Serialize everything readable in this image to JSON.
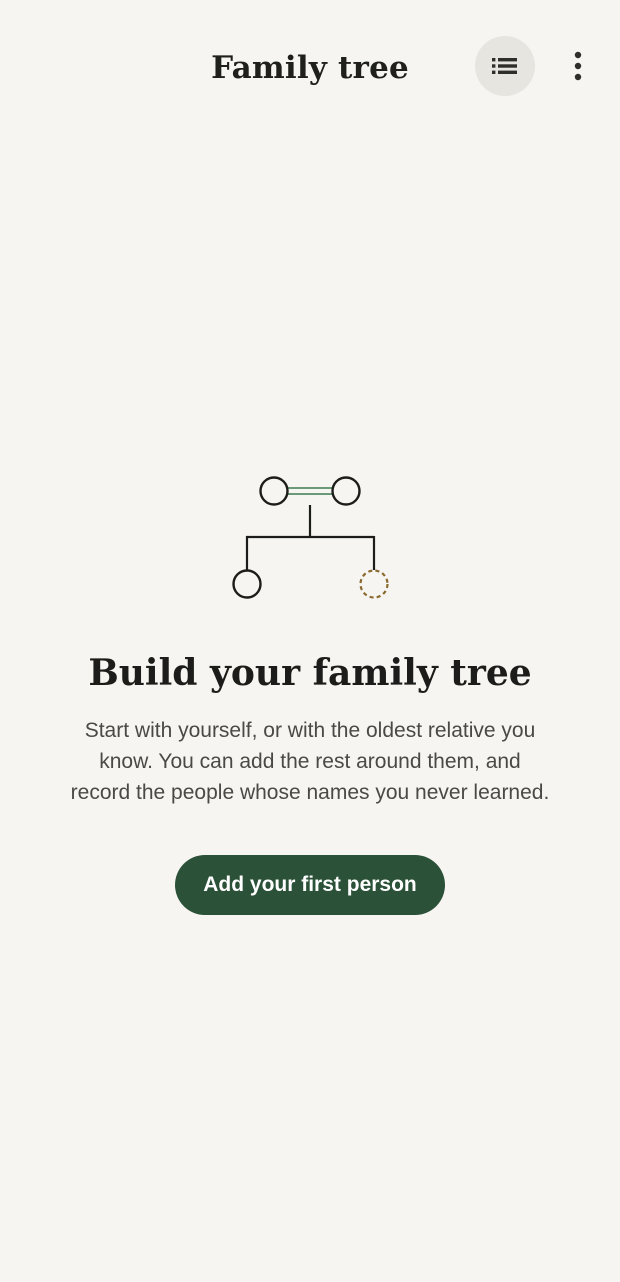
{
  "app_bar": {
    "title": "Family tree",
    "list_view_icon": "list-icon",
    "more_icon": "more-vert-icon"
  },
  "empty_state": {
    "illustration_icon": "family-tree-icon",
    "title": "Build your family tree",
    "body_lines": [
      "Start with yourself, or with the oldest relative you",
      "know. You can add the rest around them, and",
      "record the people whose names you never learned."
    ],
    "primary_action_label": "Add your first person"
  },
  "colors": {
    "background": "#f6f5f1",
    "primary": "#2b5138",
    "partner_link": "#6b9a78",
    "unknown_person_outline": "#8a6a2e",
    "icon_button_highlight": "#e6e5e0"
  }
}
